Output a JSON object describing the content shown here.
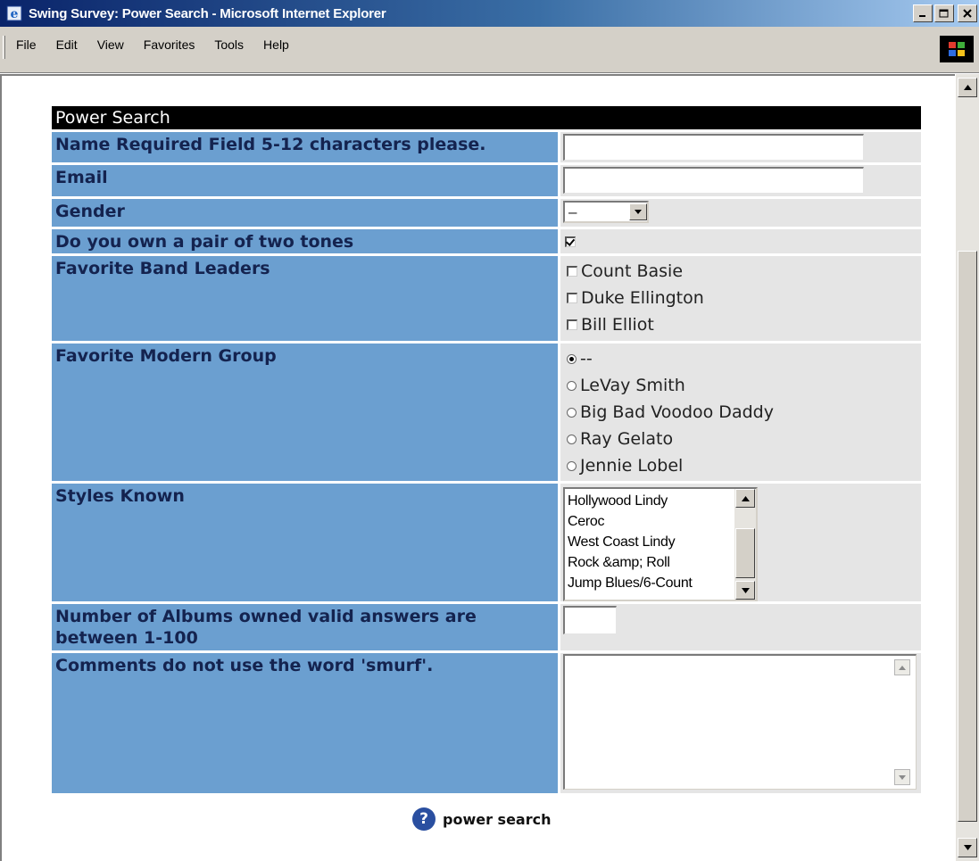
{
  "window": {
    "title": "Swing Survey: Power Search - Microsoft Internet Explorer",
    "buttons": {
      "minimize": "_",
      "maximize": "□",
      "close": "×"
    }
  },
  "menu": {
    "items": [
      "File",
      "Edit",
      "View",
      "Favorites",
      "Tools",
      "Help"
    ]
  },
  "form": {
    "title": "Power Search",
    "name_label": "Name Required Field 5-12 characters please.",
    "name_value": "",
    "email_label": "Email",
    "email_value": "",
    "gender_label": "Gender",
    "gender_selected": "–",
    "twotones_label": "Do you own a pair of two tones",
    "twotones_checked": true,
    "band_leaders_label": "Favorite Band Leaders",
    "band_leaders": [
      {
        "label": "Count Basie",
        "checked": false
      },
      {
        "label": "Duke Ellington",
        "checked": false
      },
      {
        "label": "Bill Elliot",
        "checked": false
      }
    ],
    "modern_group_label": "Favorite Modern Group",
    "modern_groups": [
      {
        "label": "--",
        "selected": true
      },
      {
        "label": "LeVay Smith",
        "selected": false
      },
      {
        "label": "Big Bad Voodoo Daddy",
        "selected": false
      },
      {
        "label": "Ray Gelato",
        "selected": false
      },
      {
        "label": "Jennie Lobel",
        "selected": false
      }
    ],
    "styles_label": "Styles Known",
    "styles_options": [
      "Hollywood Lindy",
      "Ceroc",
      "West Coast Lindy",
      "Rock &amp; Roll",
      "Jump Blues/6-Count"
    ],
    "albums_label": "Number of Albums owned valid answers are between 1-100",
    "albums_value": "",
    "comments_label": "Comments do not use the word 'smurf'.",
    "comments_value": "",
    "submit_label": "power search",
    "help_glyph": "?"
  },
  "icons": {
    "ie": "ie-logo-icon",
    "throbber": "windows-logo-icon",
    "help": "question-circle-icon"
  },
  "colors": {
    "label_bg": "#6b9fd0",
    "value_bg": "#e5e5e5",
    "header_bg": "#000000",
    "titlebar_start": "#0a246a"
  }
}
